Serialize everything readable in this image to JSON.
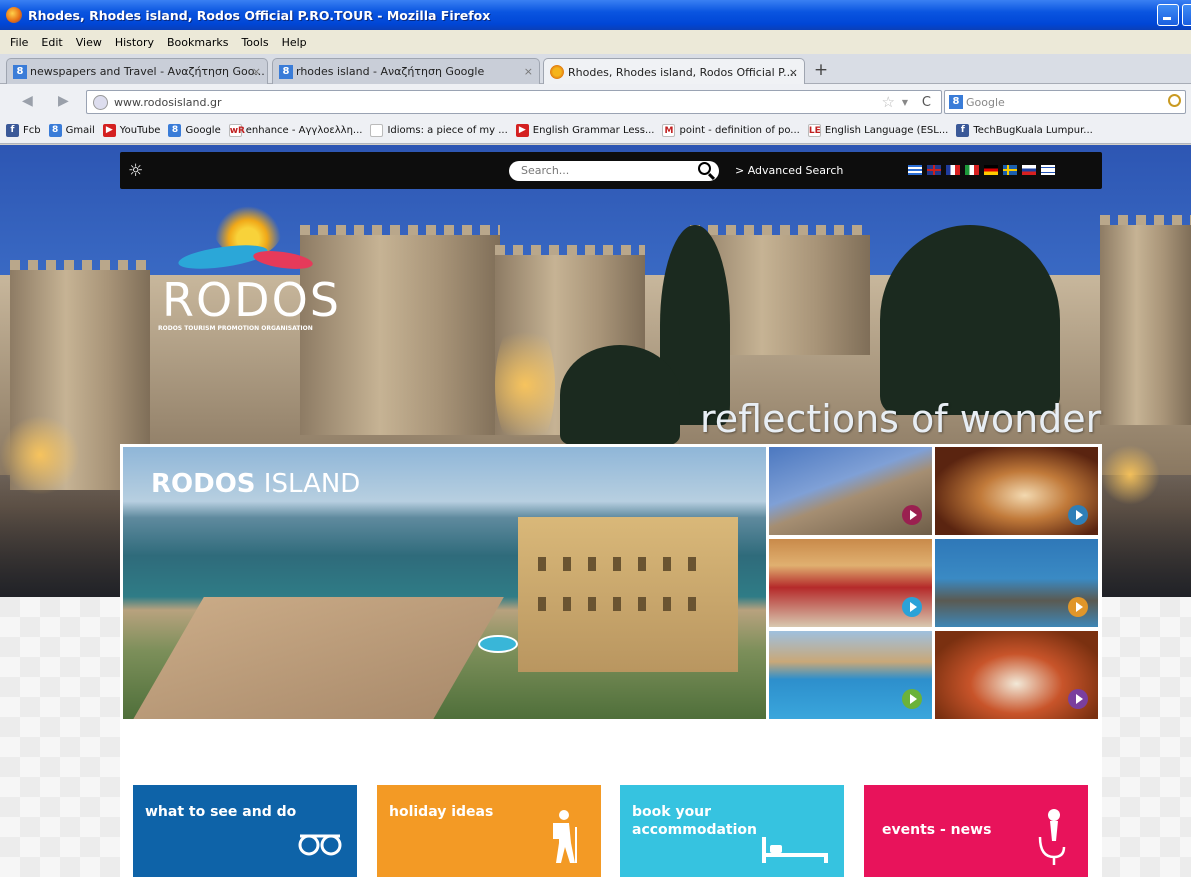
{
  "window": {
    "title": "Rhodes, Rhodes island, Rodos Official P.RO.TOUR - Mozilla Firefox"
  },
  "menu": [
    "File",
    "Edit",
    "View",
    "History",
    "Bookmarks",
    "Tools",
    "Help"
  ],
  "tabs": [
    {
      "label": "newspapers and Travel - Αναζήτηση Goo..."
    },
    {
      "label": "rhodes island - Αναζήτηση Google"
    },
    {
      "label": "Rhodes, Rhodes island, Rodos Official P...."
    }
  ],
  "nav": {
    "url": "www.rodosisland.gr",
    "search_placeholder": "Google"
  },
  "bookmarks": [
    {
      "label": "Fcb",
      "color": "#3b5998",
      "glyph": "f"
    },
    {
      "label": "Gmail",
      "color": "#3a7cd8",
      "glyph": "8"
    },
    {
      "label": "YouTube",
      "color": "#d42020",
      "glyph": "▶"
    },
    {
      "label": "Google",
      "color": "#3a7cd8",
      "glyph": "8"
    },
    {
      "label": "enhance - Αγγλοελλη...",
      "color": "#fff",
      "glyph": "wR"
    },
    {
      "label": "Idioms: a piece of my ...",
      "color": "#fff",
      "glyph": ""
    },
    {
      "label": "English Grammar Less...",
      "color": "#d42020",
      "glyph": "▶"
    },
    {
      "label": "point - definition of po...",
      "color": "#fff",
      "glyph": "M"
    },
    {
      "label": "English Language (ESL...",
      "color": "#fff",
      "glyph": "LE"
    },
    {
      "label": "TechBugKuala Lumpur...",
      "color": "#3b5998",
      "glyph": "f"
    }
  ],
  "site": {
    "search_placeholder": "Search...",
    "advanced_search": "> Advanced Search",
    "logo_word": "RODOS",
    "logo_subtitle": "RODOS TOURISM PROMOTION ORGANISATION",
    "slogan": "reflections of wonder",
    "feature_title_bold": "RODOS",
    "feature_title_rest": " ISLAND",
    "play_colors": [
      "#9a2050",
      "#2f7fb8",
      "#2aa2d8",
      "#e0962a",
      "#6bb23a",
      "#7a3f9e"
    ],
    "tiles": [
      {
        "label": "what to see and do",
        "color": "#0e63a8",
        "icon": "oo"
      },
      {
        "label": "holiday ideas",
        "color": "#f39a25",
        "icon": "hiker"
      },
      {
        "label": "book your\naccommodation",
        "color": "#36c3e0",
        "icon": "bed"
      },
      {
        "label": "events - news",
        "color": "#e8135b",
        "icon": "mic"
      }
    ]
  }
}
